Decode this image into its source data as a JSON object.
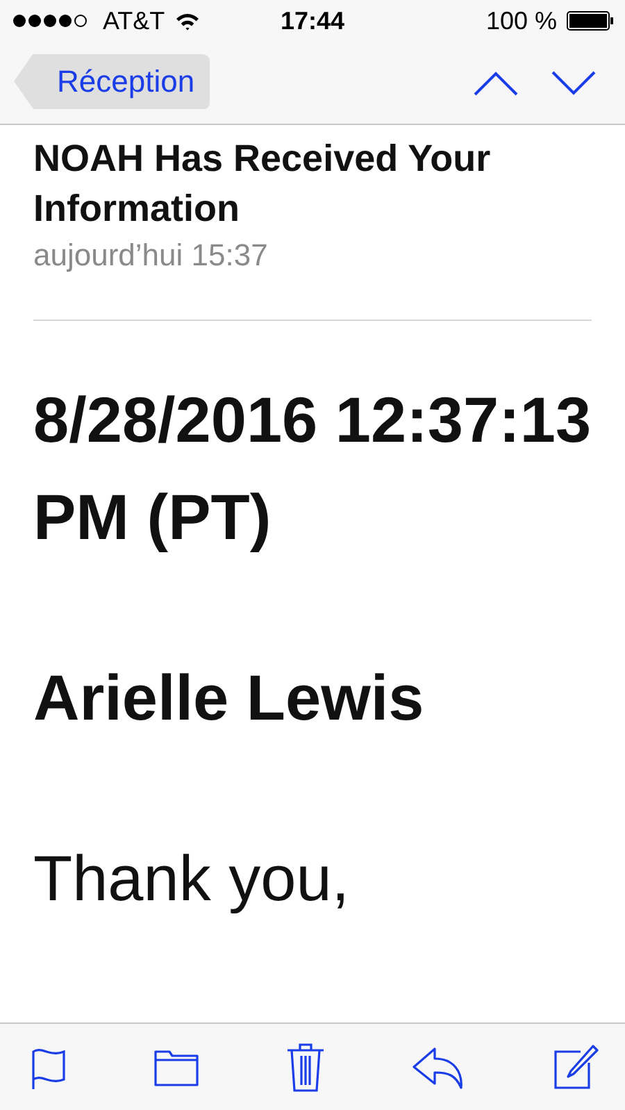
{
  "status_bar": {
    "carrier": "AT&T",
    "time": "17:44",
    "battery": "100 %"
  },
  "nav": {
    "back": "Réception"
  },
  "message": {
    "subject": "NOAH Has Received Your Information",
    "date": "aujourd’hui 15:37"
  },
  "body": [
    {
      "kind": "heading",
      "text": "8/28/2016 12:37:13 PM (PT)"
    },
    {
      "kind": "heading",
      "text": "Arielle Lewis"
    },
    {
      "kind": "text",
      "text": "Thank you,"
    }
  ]
}
